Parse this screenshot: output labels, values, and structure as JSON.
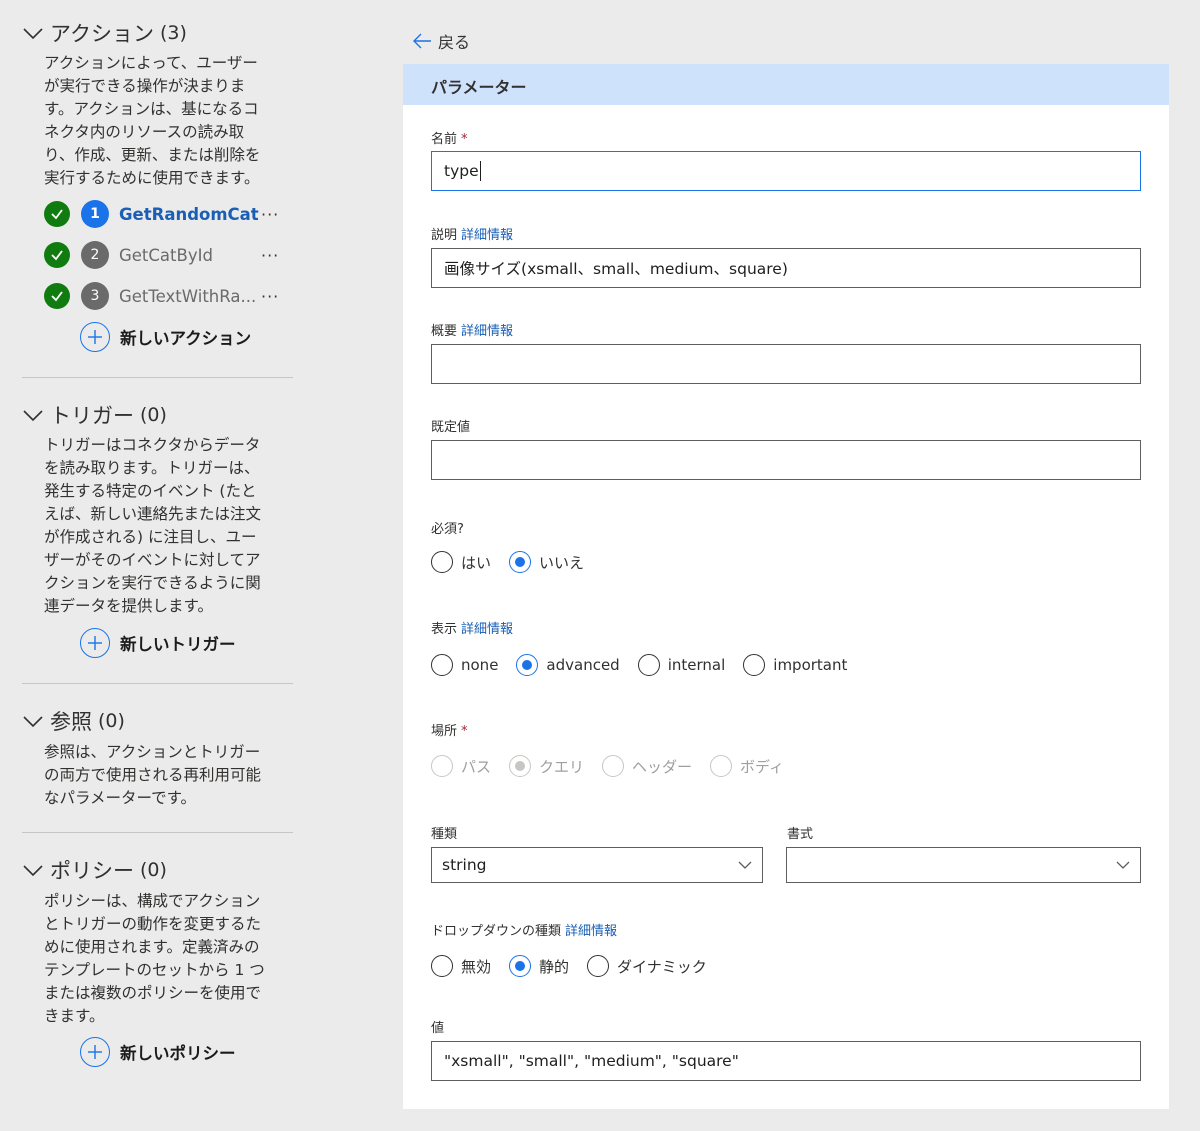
{
  "sidebar": {
    "actions": {
      "title": "アクション",
      "count": "(3)",
      "desc": [
        "アクションによって、ユーザー",
        "が実行できる操作が決まりま",
        "す。アクションは、基になるコ",
        "ネクタ内のリソースの読み取",
        "り、作成、更新、または削除を",
        "実行するために使用できます。"
      ],
      "items": [
        {
          "num": "1",
          "name": "GetRandomCat",
          "menu": "···"
        },
        {
          "num": "2",
          "name": "GetCatById",
          "menu": "···"
        },
        {
          "num": "3",
          "name": "GetTextWithRa...",
          "menu": "···"
        }
      ],
      "new_label": "新しいアクション"
    },
    "triggers": {
      "title": "トリガー",
      "count": "(0)",
      "desc": [
        "トリガーはコネクタからデータ",
        "を読み取ります。トリガーは、",
        "発生する特定のイベント (たと",
        "えば、新しい連絡先または注文",
        "が作成される) に注目し、ユー",
        "ザーがそのイベントに対してア",
        "クションを実行できるように関",
        "連データを提供します。"
      ],
      "new_label": "新しいトリガー"
    },
    "references": {
      "title": "参照",
      "count": "(0)",
      "desc": [
        "参照は、アクションとトリガー",
        "の両方で使用される再利用可能",
        "なパラメーターです。"
      ]
    },
    "policies": {
      "title": "ポリシー",
      "count": "(0)",
      "desc": [
        "ポリシーは、構成でアクション",
        "とトリガーの動作を変更するた",
        "めに使用されます。定義済みの",
        "テンプレートのセットから 1 つ",
        "または複数のポリシーを使用で",
        "きます。"
      ],
      "new_label": "新しいポリシー"
    }
  },
  "main": {
    "back_label": "戻る",
    "panel_title": "パラメーター",
    "more_info": "詳細情報",
    "required_mark": "*",
    "name": {
      "label": "名前",
      "value": "type"
    },
    "description": {
      "label": "説明",
      "value": "画像サイズ(xsmall、small、medium、square)"
    },
    "summary": {
      "label": "概要",
      "value": ""
    },
    "default": {
      "label": "既定値",
      "value": ""
    },
    "required": {
      "label": "必須?",
      "options": [
        "はい",
        "いいえ"
      ],
      "selected": "いいえ"
    },
    "visibility": {
      "label": "表示",
      "options": [
        "none",
        "advanced",
        "internal",
        "important"
      ],
      "selected": "advanced"
    },
    "location": {
      "label": "場所",
      "options": [
        "パス",
        "クエリ",
        "ヘッダー",
        "ボディ"
      ],
      "selected": "クエリ"
    },
    "type": {
      "label": "種類",
      "value": "string"
    },
    "format": {
      "label": "書式",
      "value": ""
    },
    "dropdown_type": {
      "label": "ドロップダウンの種類",
      "options": [
        "無効",
        "静的",
        "ダイナミック"
      ],
      "selected": "静的"
    },
    "values": {
      "label": "値",
      "value": "\"xsmall\", \"small\", \"medium\", \"square\""
    }
  },
  "colors": {
    "accent": "#1a73e8",
    "success": "#107c10",
    "header_bg": "#cfe2fb"
  }
}
